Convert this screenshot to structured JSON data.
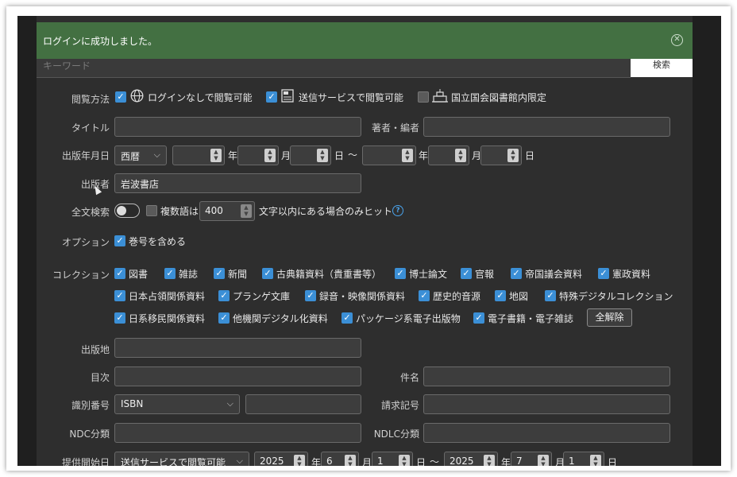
{
  "toast": {
    "message": "ログインに成功しました。",
    "close_icon": "circle-x-icon"
  },
  "keyword": {
    "placeholder": "キーワード",
    "search_label": "検索"
  },
  "view_method": {
    "label": "閲覧方法",
    "options": [
      {
        "label": "ログインなしで閲覧可能",
        "checked": true,
        "icon": "globe-icon"
      },
      {
        "label": "送信サービスで閲覧可能",
        "checked": true,
        "icon": "server-icon"
      },
      {
        "label": "国立国会図書館内限定",
        "checked": false,
        "icon": "library-icon"
      }
    ]
  },
  "title": {
    "label": "タイトル",
    "value": ""
  },
  "author": {
    "label": "著者・編者",
    "value": ""
  },
  "pubdate": {
    "label": "出版年月日",
    "era": "西暦",
    "year_unit": "年",
    "month_unit": "月",
    "day_unit": "日",
    "range_sep": "〜"
  },
  "publisher": {
    "label": "出版者",
    "value": "岩波書店"
  },
  "fulltext": {
    "label": "全文検索",
    "toggle_on": false,
    "multi_label": "複数語は",
    "multi_checked": false,
    "distance": "400",
    "suffix": "文字以内にある場合のみヒット",
    "help_icon": "question-icon"
  },
  "option": {
    "label": "オプション",
    "item": "巻号を含める",
    "checked": true
  },
  "collection": {
    "label": "コレクション",
    "row1": [
      "図書",
      "雑誌",
      "新聞",
      "古典籍資料（貴重書等）",
      "博士論文",
      "官報",
      "帝国議会資料",
      "憲政資料"
    ],
    "row2": [
      "日本占領関係資料",
      "プランゲ文庫",
      "録音・映像関係資料",
      "歴史的音源",
      "地図",
      "特殊デジタルコレクション"
    ],
    "row3": [
      "日系移民関係資料",
      "他機関デジタル化資料",
      "パッケージ系電子出版物",
      "電子書籍・電子雑誌"
    ],
    "clear_all": "全解除"
  },
  "place": {
    "label": "出版地",
    "value": ""
  },
  "toc": {
    "label": "目次",
    "value": ""
  },
  "subject": {
    "label": "件名",
    "value": ""
  },
  "identifier": {
    "label": "識別番号",
    "type": "ISBN",
    "value": ""
  },
  "callno": {
    "label": "請求記号",
    "value": ""
  },
  "ndc": {
    "label": "NDC分類",
    "value": ""
  },
  "ndlc": {
    "label": "NDLC分類",
    "value": ""
  },
  "provided": {
    "label": "提供開始日",
    "mode": "送信サービスで閲覧可能",
    "from": {
      "year": "2025",
      "month": "6",
      "day": "1"
    },
    "to": {
      "year": "2025",
      "month": "7",
      "day": "1"
    }
  }
}
